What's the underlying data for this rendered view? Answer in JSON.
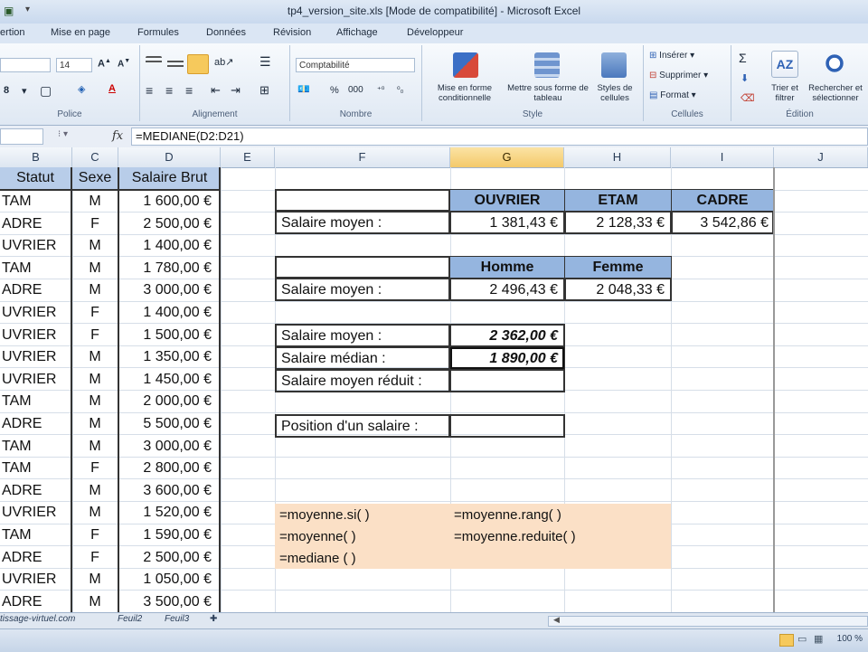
{
  "window": {
    "title": "tp4_version_site.xls  [Mode de compatibilité] - Microsoft Excel"
  },
  "tabs": [
    "ertion",
    "Mise en page",
    "Formules",
    "Données",
    "Révision",
    "Affichage",
    "Développeur"
  ],
  "ribbon": {
    "font_size": "14",
    "number_format": "Comptabilité",
    "groups": {
      "police": "Police",
      "alignement": "Alignement",
      "nombre": "Nombre",
      "style": "Style",
      "cellules": "Cellules",
      "edition": "Édition"
    },
    "buttons": {
      "mise_en_forme_cond": "Mise en forme conditionnelle",
      "mettre_sous_forme": "Mettre sous forme de tableau",
      "styles_cellules": "Styles de cellules",
      "inserer": "Insérer",
      "supprimer": "Supprimer",
      "format": "Format",
      "trier": "Trier et filtrer",
      "rechercher": "Rechercher et sélectionner",
      "percent": "%",
      "sigma": "Σ"
    }
  },
  "formula_bar": {
    "fx": "fx",
    "formula": "=MEDIANE(D2:D21)"
  },
  "columns": [
    "B",
    "C",
    "D",
    "E",
    "F",
    "G",
    "H",
    "I",
    "J"
  ],
  "table": {
    "headers": [
      "Statut",
      "Sexe",
      "Salaire Brut"
    ],
    "rows": [
      [
        "TAM",
        "M",
        "1 600,00 €"
      ],
      [
        "ADRE",
        "F",
        "2 500,00 €"
      ],
      [
        "UVRIER",
        "M",
        "1 400,00 €"
      ],
      [
        "TAM",
        "M",
        "1 780,00 €"
      ],
      [
        "ADRE",
        "M",
        "3 000,00 €"
      ],
      [
        "UVRIER",
        "F",
        "1 400,00 €"
      ],
      [
        "UVRIER",
        "F",
        "1 500,00 €"
      ],
      [
        "UVRIER",
        "M",
        "1 350,00 €"
      ],
      [
        "UVRIER",
        "M",
        "1 450,00 €"
      ],
      [
        "TAM",
        "M",
        "2 000,00 €"
      ],
      [
        "ADRE",
        "M",
        "5 500,00 €"
      ],
      [
        "TAM",
        "M",
        "3 000,00 €"
      ],
      [
        "TAM",
        "F",
        "2 800,00 €"
      ],
      [
        "ADRE",
        "M",
        "3 600,00 €"
      ],
      [
        "UVRIER",
        "M",
        "1 520,00 €"
      ],
      [
        "TAM",
        "F",
        "1 590,00 €"
      ],
      [
        "ADRE",
        "F",
        "2 500,00 €"
      ],
      [
        "UVRIER",
        "M",
        "1 050,00 €"
      ],
      [
        "ADRE",
        "M",
        "3 500,00 €"
      ]
    ]
  },
  "stats1": {
    "headers": [
      "OUVRIER",
      "ETAM",
      "CADRE"
    ],
    "label": "Salaire moyen :",
    "values": [
      "1 381,43 €",
      "2 128,33 €",
      "3 542,86 €"
    ]
  },
  "stats2": {
    "headers": [
      "Homme",
      "Femme"
    ],
    "label": "Salaire moyen :",
    "values": [
      "2 496,43 €",
      "2 048,33 €"
    ]
  },
  "stats3": {
    "rows": [
      {
        "label": "Salaire moyen :",
        "value": "2 362,00 €"
      },
      {
        "label": "Salaire médian :",
        "value": "1 890,00 €"
      },
      {
        "label": "Salaire moyen réduit :",
        "value": ""
      }
    ]
  },
  "stats4": {
    "label": "Position d'un salaire :",
    "value": ""
  },
  "notes": {
    "left": [
      "=moyenne.si( )",
      "=moyenne( )",
      "=mediane ( )"
    ],
    "right": [
      "=moyenne.rang( )",
      "=moyenne.reduite( )"
    ]
  },
  "sheet_tabs": [
    "tissage-virtuel.com",
    "Feuil2",
    "Feuil3"
  ],
  "status": {
    "zoom": "100 %"
  }
}
